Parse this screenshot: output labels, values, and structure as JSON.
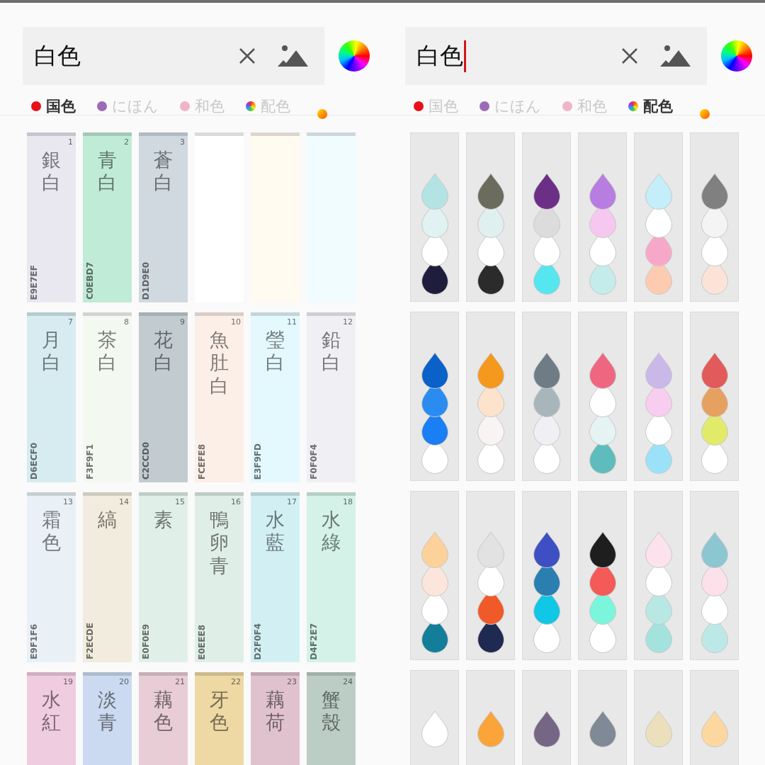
{
  "panels": [
    {
      "kind": "swatches",
      "search": {
        "value": "白色",
        "focused": false
      },
      "tabs": [
        {
          "kind": "dot",
          "color": "#e8101a",
          "label": "国色",
          "selected": true
        },
        {
          "kind": "dot",
          "color": "#9b6bb8",
          "label": "にほん",
          "selected": false
        },
        {
          "kind": "dot",
          "color": "#f0b4c8",
          "label": "和色",
          "selected": false
        },
        {
          "kind": "rainbow",
          "label": "配色",
          "selected": false
        },
        {
          "kind": "gradient",
          "selected": false
        }
      ],
      "colors": [
        {
          "number": "1",
          "name": "銀白",
          "hex": "E9E7EF",
          "color": "#e9e7ef"
        },
        {
          "number": "2",
          "name": "青白",
          "hex": "C0EBD7",
          "color": "#c0ebd7"
        },
        {
          "number": "3",
          "name": "蒼白",
          "hex": "D1D9E0",
          "color": "#d1d9e0"
        },
        {
          "color": "#ffffff"
        },
        {
          "color": "#fffbf0"
        },
        {
          "color": "#f0fcff"
        },
        {
          "number": "7",
          "name": "月白",
          "hex": "D6ECF0",
          "color": "#d6ecf0"
        },
        {
          "number": "8",
          "name": "茶白",
          "hex": "F3F9F1",
          "color": "#f3f9f1"
        },
        {
          "number": "9",
          "name": "花白",
          "hex": "C2CCD0",
          "color": "#c2ccd0"
        },
        {
          "number": "10",
          "name": "魚肚白",
          "hex": "FCEFE8",
          "color": "#fcefe8"
        },
        {
          "number": "11",
          "name": "瑩白",
          "hex": "E3F9FD",
          "color": "#e3f9fd"
        },
        {
          "number": "12",
          "name": "鉛白",
          "hex": "F0F0F4",
          "color": "#f0f0f4"
        },
        {
          "number": "13",
          "name": "霜色",
          "hex": "E9F1F6",
          "color": "#e9f1f6"
        },
        {
          "number": "14",
          "name": "縞",
          "hex": "F2ECDE",
          "color": "#f2ecde"
        },
        {
          "number": "15",
          "name": "素",
          "hex": "E0F0E9",
          "color": "#e0f0e9"
        },
        {
          "number": "16",
          "name": "鴨卵青",
          "hex": "E0EEE8",
          "color": "#e0eee8"
        },
        {
          "number": "17",
          "name": "水藍",
          "hex": "D2F0F4",
          "color": "#d2f0f4"
        },
        {
          "number": "18",
          "name": "水綠",
          "hex": "D4F2E7",
          "color": "#d4f2e7"
        },
        {
          "number": "19",
          "name": "水紅",
          "color": "#f0cce0"
        },
        {
          "number": "20",
          "name": "淡青",
          "color": "#cbdaf0"
        },
        {
          "number": "21",
          "name": "藕色",
          "color": "#e8ccd6"
        },
        {
          "number": "22",
          "name": "牙色",
          "color": "#eed9a4"
        },
        {
          "number": "23",
          "name": "藕荷",
          "color": "#e0c2cf"
        },
        {
          "number": "24",
          "name": "蟹殼",
          "color": "#bccdc6"
        }
      ]
    },
    {
      "kind": "palettes",
      "search": {
        "value": "白色",
        "focused": true
      },
      "tabs": [
        {
          "kind": "dot",
          "color": "#e8101a",
          "label": "国色",
          "selected": false
        },
        {
          "kind": "dot",
          "color": "#9b6bb8",
          "label": "にほん",
          "selected": false
        },
        {
          "kind": "dot",
          "color": "#f0b4c8",
          "label": "和色",
          "selected": false
        },
        {
          "kind": "rainbow",
          "label": "配色",
          "selected": true
        },
        {
          "kind": "gradient",
          "selected": false
        }
      ],
      "palettes": [
        {
          "drops": [
            {
              "color": "#b3e3e3"
            },
            {
              "color": "#e0f2f2"
            },
            {
              "color": "#ffffff"
            },
            {
              "color": "#1e1e3c"
            }
          ]
        },
        {
          "drops": [
            {
              "color": "#6b6b5e"
            },
            {
              "color": "#dff0ef"
            },
            {
              "color": "#ffffff"
            },
            {
              "color": "#2b2b2b"
            }
          ]
        },
        {
          "drops": [
            {
              "color": "#6b2f86"
            },
            {
              "color": "#dcdcdc"
            },
            {
              "color": "#ffffff"
            },
            {
              "color": "#55e6f0"
            }
          ]
        },
        {
          "drops": [
            {
              "color": "#b87de0"
            },
            {
              "color": "#f6c8f0"
            },
            {
              "color": "#ffffff"
            },
            {
              "color": "#c4ecea"
            }
          ]
        },
        {
          "drops": [
            {
              "color": "#c4eefa"
            },
            {
              "color": "#ffffff"
            },
            {
              "color": "#f7a8c8"
            },
            {
              "color": "#fccbb0"
            }
          ]
        },
        {
          "drops": [
            {
              "color": "#808080"
            },
            {
              "color": "#f4f4f4"
            },
            {
              "color": "#ffffff"
            },
            {
              "color": "#fce3d8"
            }
          ]
        },
        {
          "drops": [
            {
              "color": "#0a62c8"
            },
            {
              "color": "#2a8cf0"
            },
            {
              "color": "#1a7ef5"
            },
            {
              "color": "#ffffff"
            }
          ]
        },
        {
          "drops": [
            {
              "color": "#f5981e"
            },
            {
              "color": "#fde3cc"
            },
            {
              "color": "#f8f4f4"
            },
            {
              "color": "#ffffff"
            }
          ]
        },
        {
          "drops": [
            {
              "color": "#6e7c86"
            },
            {
              "color": "#a8b6bc"
            },
            {
              "color": "#f0f0f4"
            },
            {
              "color": "#ffffff"
            }
          ]
        },
        {
          "drops": [
            {
              "color": "#ef6680"
            },
            {
              "color": "#ffffff"
            },
            {
              "color": "#e5f4f2"
            },
            {
              "color": "#5ebcbc"
            }
          ]
        },
        {
          "drops": [
            {
              "color": "#c9b8e8"
            },
            {
              "color": "#f8cdf0"
            },
            {
              "color": "#ffffff"
            },
            {
              "color": "#9be2f8"
            }
          ]
        },
        {
          "drops": [
            {
              "color": "#e25a5a"
            },
            {
              "color": "#e6a060"
            },
            {
              "color": "#e2ea6a"
            },
            {
              "color": "#ffffff"
            }
          ]
        },
        {
          "drops": [
            {
              "color": "#fcd29a"
            },
            {
              "color": "#fce6dc"
            },
            {
              "color": "#ffffff"
            },
            {
              "color": "#137e9a"
            }
          ]
        },
        {
          "drops": [
            {
              "color": "#e2e2e2"
            },
            {
              "color": "#ffffff"
            },
            {
              "color": "#f05a28"
            },
            {
              "color": "#1f2a52"
            }
          ]
        },
        {
          "drops": [
            {
              "color": "#3e4fc4"
            },
            {
              "color": "#2b7eb0"
            },
            {
              "color": "#10c7e6"
            },
            {
              "color": "#ffffff"
            }
          ]
        },
        {
          "drops": [
            {
              "color": "#1e1e1e"
            },
            {
              "color": "#f45a58"
            },
            {
              "color": "#7cf5dd"
            },
            {
              "color": "#ffffff"
            }
          ]
        },
        {
          "drops": [
            {
              "color": "#fce2ec"
            },
            {
              "color": "#ffffff"
            },
            {
              "color": "#b8e8e4"
            },
            {
              "color": "#a4e2de"
            }
          ]
        },
        {
          "drops": [
            {
              "color": "#8cc6d0"
            },
            {
              "color": "#fce0ea"
            },
            {
              "color": "#ffffff"
            },
            {
              "color": "#bde8e8"
            }
          ]
        },
        {
          "drops": [
            {
              "color": "#ffffff"
            }
          ]
        },
        {
          "drops": [
            {
              "color": "#fba43a"
            }
          ]
        },
        {
          "drops": [
            {
              "color": "#766685"
            }
          ]
        },
        {
          "drops": [
            {
              "color": "#7f8a96"
            }
          ]
        },
        {
          "drops": [
            {
              "color": "#ece0bc"
            }
          ]
        },
        {
          "drops": [
            {
              "color": "#fdd7a0"
            }
          ]
        }
      ]
    }
  ]
}
